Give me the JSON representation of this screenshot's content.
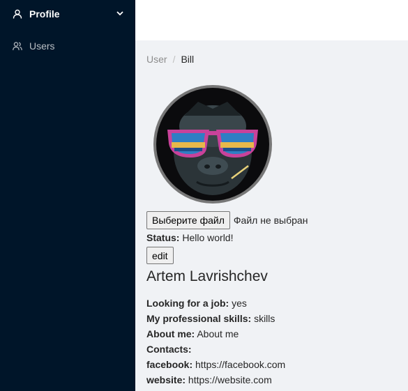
{
  "sidebar": {
    "items": [
      {
        "label": "Profile",
        "icon": "user-icon",
        "expanded": true
      },
      {
        "label": "Users",
        "icon": "team-icon"
      }
    ]
  },
  "breadcrumb": {
    "parent": "User",
    "separator": "/",
    "current": "Bill"
  },
  "profile": {
    "file_button": "Выберите файл",
    "file_status": "Файл не выбран",
    "status_label": "Status:",
    "status_value": "Hello world!",
    "edit_label": "edit",
    "full_name": "Artem Lavrishchev",
    "job_label": "Looking for a job:",
    "job_value": "yes",
    "skills_label": "My professional skills:",
    "skills_value": "skills",
    "about_label": "About me:",
    "about_value": "About me",
    "contacts_label": "Contacts:",
    "contacts": [
      {
        "label": "facebook:",
        "value": "https://facebook.com"
      },
      {
        "label": "website:",
        "value": "https://website.com"
      }
    ]
  },
  "colors": {
    "sidebar_bg": "#001529",
    "content_bg": "#f0f2f5",
    "header_bg": "#ffffff"
  }
}
